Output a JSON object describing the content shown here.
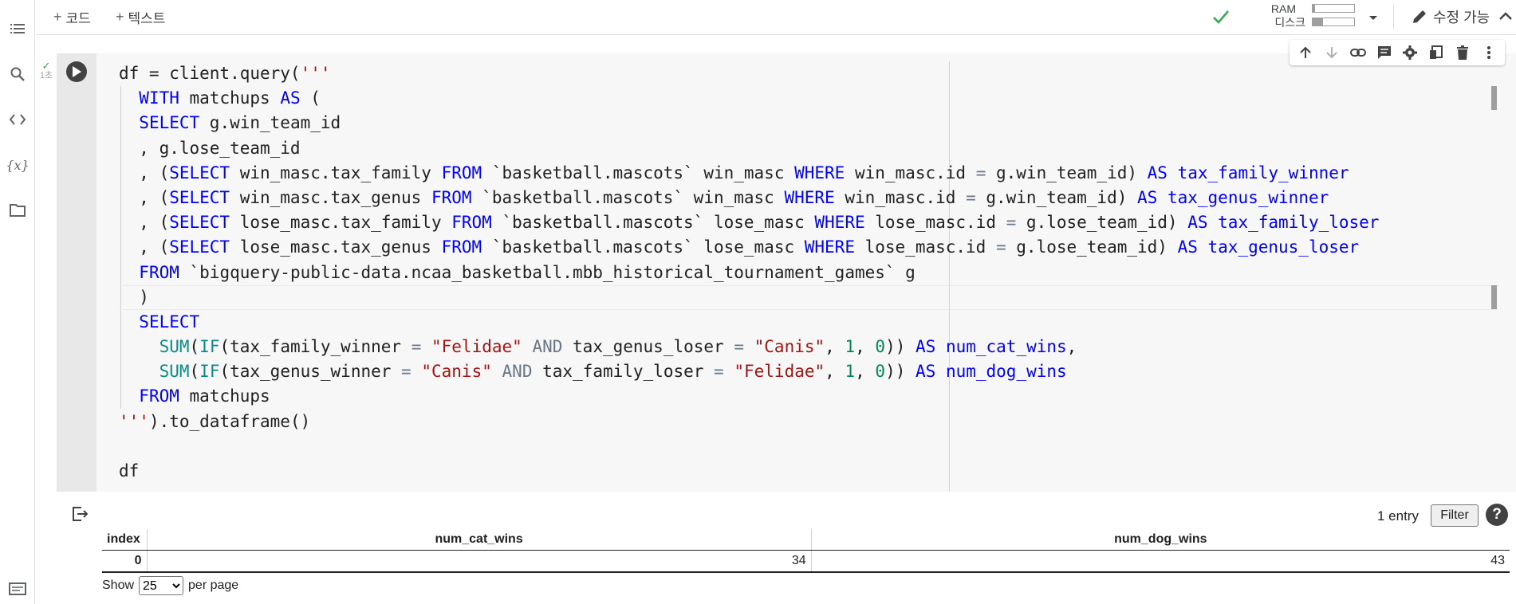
{
  "toolbar": {
    "add_code_label": "코드",
    "add_text_label": "텍스트",
    "ram_label": "RAM",
    "disk_label": "디스크",
    "ram_usage": 0.06,
    "disk_usage": 0.25,
    "edit_label": "수정 가능"
  },
  "cell": {
    "exec_time": "1초",
    "code_lines": [
      [
        [
          "",
          "df = client.query("
        ],
        [
          "str",
          "'''"
        ]
      ],
      [
        [
          "",
          "  "
        ],
        [
          "kw",
          "WITH"
        ],
        [
          "",
          " matchups "
        ],
        [
          "kw",
          "AS"
        ],
        [
          "",
          " ("
        ]
      ],
      [
        [
          "",
          "  "
        ],
        [
          "kw",
          "SELECT"
        ],
        [
          "",
          " g.win_team_id"
        ]
      ],
      [
        [
          "",
          "  , g.lose_team_id"
        ]
      ],
      [
        [
          "",
          "  , ("
        ],
        [
          "kw",
          "SELECT"
        ],
        [
          "",
          " win_masc.tax_family "
        ],
        [
          "kw",
          "FROM"
        ],
        [
          "",
          " `basketball.mascots` win_masc "
        ],
        [
          "kw",
          "WHERE"
        ],
        [
          "",
          " win_masc.id "
        ],
        [
          "op",
          "="
        ],
        [
          "",
          " g.win_team_id) "
        ],
        [
          "kw",
          "AS"
        ],
        [
          "kw",
          " tax_family_winner"
        ]
      ],
      [
        [
          "",
          "  , ("
        ],
        [
          "kw",
          "SELECT"
        ],
        [
          "",
          " win_masc.tax_genus "
        ],
        [
          "kw",
          "FROM"
        ],
        [
          "",
          " `basketball.mascots` win_masc "
        ],
        [
          "kw",
          "WHERE"
        ],
        [
          "",
          " win_masc.id "
        ],
        [
          "op",
          "="
        ],
        [
          "",
          " g.win_team_id) "
        ],
        [
          "kw",
          "AS"
        ],
        [
          "kw",
          " tax_genus_winner"
        ]
      ],
      [
        [
          "",
          "  , ("
        ],
        [
          "kw",
          "SELECT"
        ],
        [
          "",
          " lose_masc.tax_family "
        ],
        [
          "kw",
          "FROM"
        ],
        [
          "",
          " `basketball.mascots` lose_masc "
        ],
        [
          "kw",
          "WHERE"
        ],
        [
          "",
          " lose_masc.id "
        ],
        [
          "op",
          "="
        ],
        [
          "",
          " g.lose_team_id) "
        ],
        [
          "kw",
          "AS"
        ],
        [
          "kw",
          " tax_family_loser"
        ]
      ],
      [
        [
          "",
          "  , ("
        ],
        [
          "kw",
          "SELECT"
        ],
        [
          "",
          " lose_masc.tax_genus "
        ],
        [
          "kw",
          "FROM"
        ],
        [
          "",
          " `basketball.mascots` lose_masc "
        ],
        [
          "kw",
          "WHERE"
        ],
        [
          "",
          " lose_masc.id "
        ],
        [
          "op",
          "="
        ],
        [
          "",
          " g.lose_team_id) "
        ],
        [
          "kw",
          "AS"
        ],
        [
          "kw",
          " tax_genus_loser"
        ]
      ],
      [
        [
          "",
          "  "
        ],
        [
          "kw",
          "FROM"
        ],
        [
          "",
          " `bigquery-public-data.ncaa_basketball.mbb_historical_tournament_games` g"
        ]
      ],
      [
        [
          "",
          "  )"
        ]
      ],
      [
        [
          "",
          "  "
        ],
        [
          "kw",
          "SELECT"
        ]
      ],
      [
        [
          "",
          "    "
        ],
        [
          "fn",
          "SUM"
        ],
        [
          "",
          "("
        ],
        [
          "fn",
          "IF"
        ],
        [
          "",
          "(tax_family_winner "
        ],
        [
          "op",
          "="
        ],
        [
          "",
          " "
        ],
        [
          "str",
          "\"Felidae\""
        ],
        [
          "",
          " "
        ],
        [
          "op",
          "AND"
        ],
        [
          "",
          " tax_genus_loser "
        ],
        [
          "op",
          "="
        ],
        [
          "",
          " "
        ],
        [
          "str",
          "\"Canis\""
        ],
        [
          "",
          ", "
        ],
        [
          "num",
          "1"
        ],
        [
          "",
          ", "
        ],
        [
          "num",
          "0"
        ],
        [
          "",
          ")) "
        ],
        [
          "kw",
          "AS"
        ],
        [
          "kw",
          " num_cat_wins"
        ],
        [
          "",
          ","
        ]
      ],
      [
        [
          "",
          "    "
        ],
        [
          "fn",
          "SUM"
        ],
        [
          "",
          "("
        ],
        [
          "fn",
          "IF"
        ],
        [
          "",
          "(tax_genus_winner "
        ],
        [
          "op",
          "="
        ],
        [
          "",
          " "
        ],
        [
          "str",
          "\"Canis\""
        ],
        [
          "",
          " "
        ],
        [
          "op",
          "AND"
        ],
        [
          "",
          " tax_family_loser "
        ],
        [
          "op",
          "="
        ],
        [
          "",
          " "
        ],
        [
          "str",
          "\"Felidae\""
        ],
        [
          "",
          ", "
        ],
        [
          "num",
          "1"
        ],
        [
          "",
          ", "
        ],
        [
          "num",
          "0"
        ],
        [
          "",
          ")) "
        ],
        [
          "kw",
          "AS"
        ],
        [
          "kw",
          " num_dog_wins"
        ]
      ],
      [
        [
          "",
          "  "
        ],
        [
          "kw",
          "FROM"
        ],
        [
          "",
          " matchups"
        ]
      ],
      [
        [
          "str",
          "'''"
        ],
        [
          "",
          ").to_dataframe()"
        ]
      ],
      [
        [
          "",
          ""
        ]
      ],
      [
        [
          "",
          "df"
        ]
      ]
    ]
  },
  "output": {
    "entries_label": "1 entry",
    "filter_label": "Filter",
    "help_label": "?",
    "columns": [
      "index",
      "num_cat_wins",
      "num_dog_wins"
    ],
    "rows": [
      [
        "0",
        "34",
        "43"
      ]
    ],
    "show_label": "Show",
    "per_page_label": "per page",
    "page_size": "25"
  }
}
